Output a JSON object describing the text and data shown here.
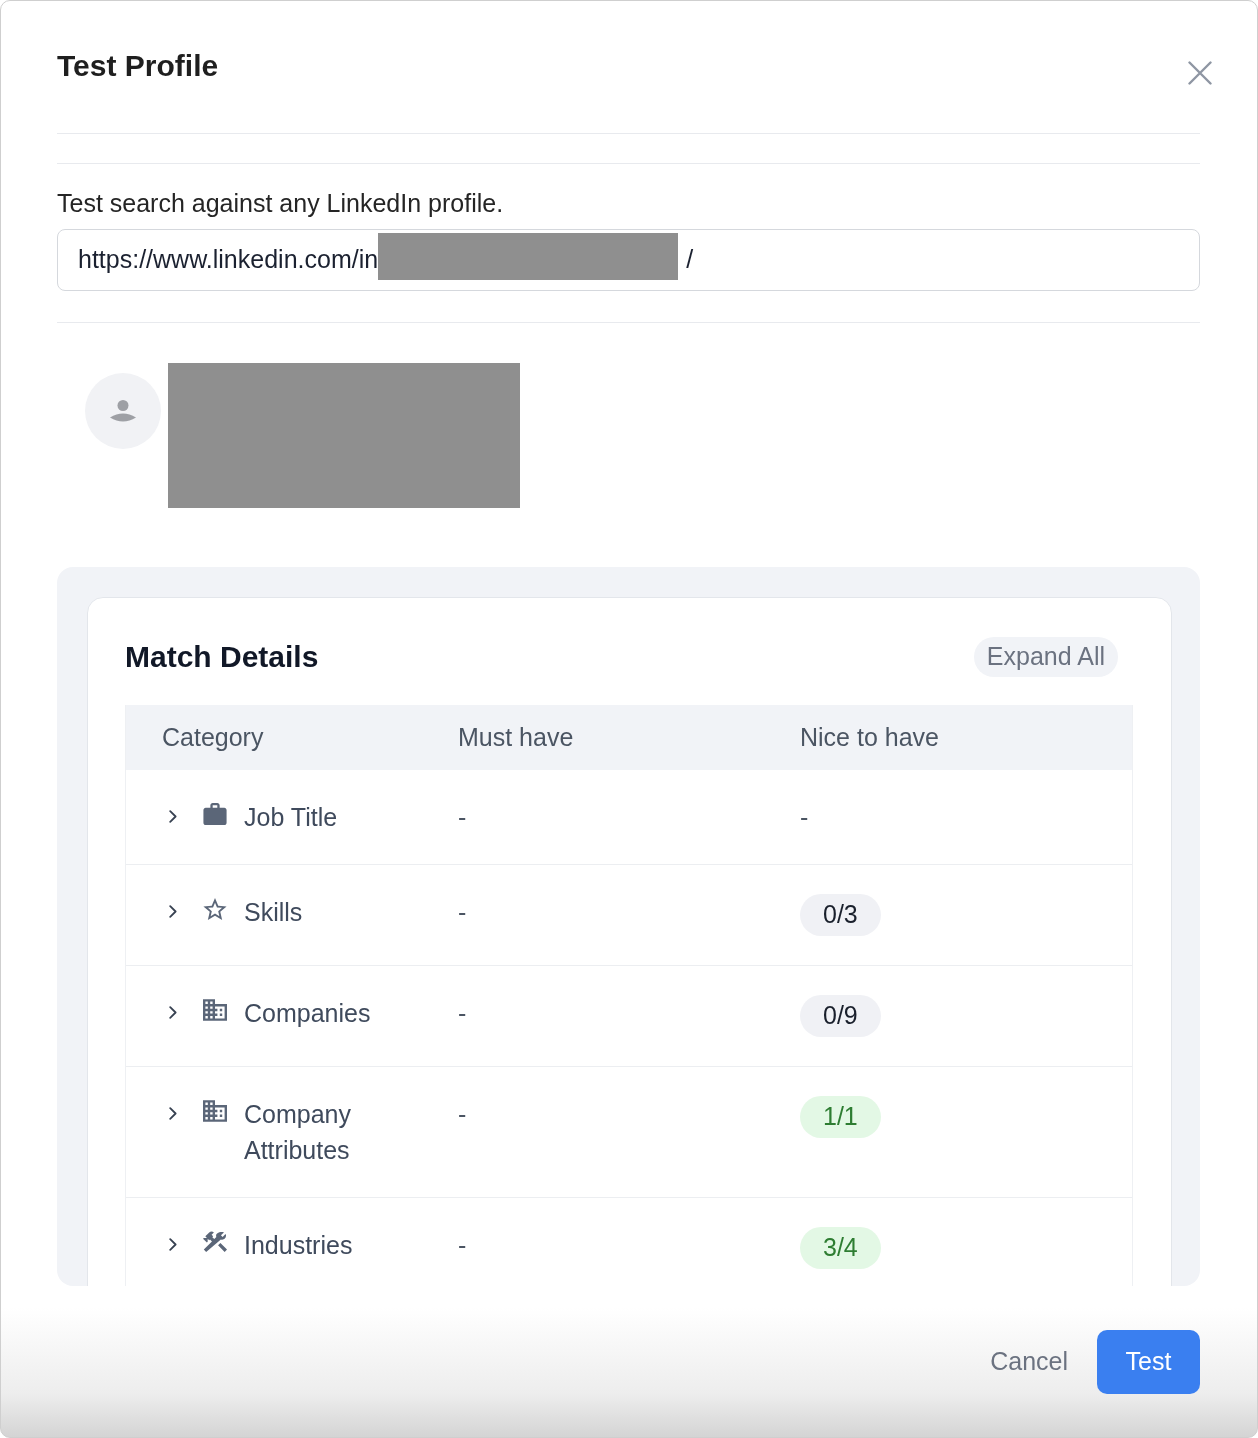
{
  "dialog": {
    "title": "Test Profile"
  },
  "url_field": {
    "label": "Test search against any LinkedIn profile.",
    "value": [
      "https://www.linkedin.com/in",
      "/"
    ]
  },
  "match_details": {
    "title": "Match Details",
    "expand_all": "Expand All",
    "columns": [
      "Category",
      "Must have",
      "Nice to have"
    ],
    "rows": [
      {
        "category": "Job Title",
        "expanded": false,
        "must_have": "-",
        "nice_to_have": {
          "kind": "plain",
          "text": "-"
        }
      },
      {
        "category": "Skills",
        "expanded": false,
        "must_have": "-",
        "nice_to_have": {
          "kind": "badge",
          "text": "0/3",
          "color": "#f0f1f5"
        }
      },
      {
        "category": "Companies",
        "expanded": false,
        "must_have": "-",
        "nice_to_have": {
          "kind": "badge",
          "text": "0/9",
          "color": "#f0f1f5"
        }
      },
      {
        "category": "Company Attributes",
        "expanded": false,
        "must_have": "-",
        "nice_to_have": {
          "kind": "badge",
          "text": "1/1",
          "color": "#e3f8e5"
        }
      },
      {
        "category": "Industries",
        "expanded": false,
        "must_have": "-",
        "nice_to_have": {
          "kind": "badge",
          "text": "3/4",
          "color": "#e3f8e5"
        }
      }
    ]
  },
  "footer": {
    "buttons": [
      {
        "label": "Cancel",
        "kind": "secondary"
      },
      {
        "label": "Test",
        "kind": "primary"
      }
    ]
  }
}
